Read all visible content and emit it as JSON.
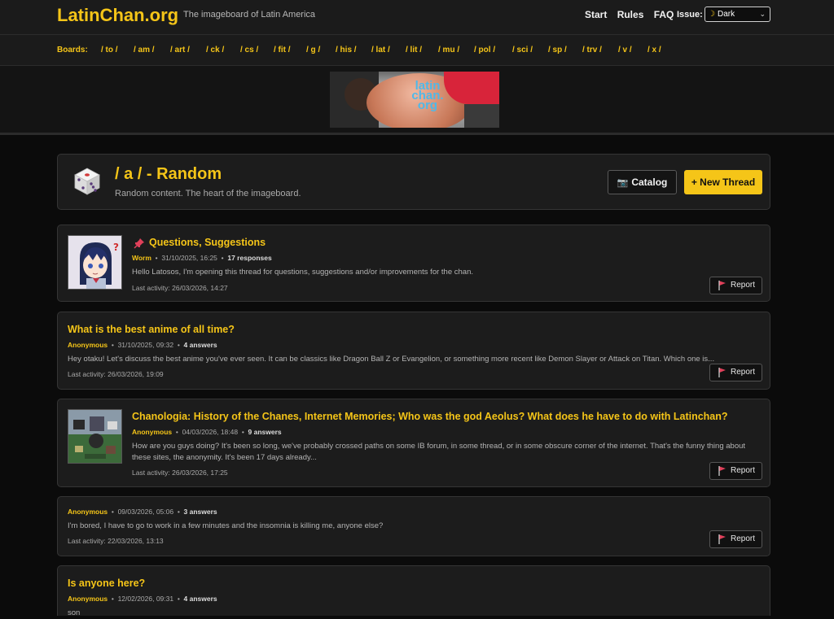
{
  "header": {
    "logo": "LatinChan.org",
    "tagline": "The imageboard of Latin America",
    "nav": [
      "Start",
      "Rules",
      "FAQ"
    ],
    "theme_label": "Issue:",
    "theme_value": "Dark"
  },
  "boards": {
    "label": "Boards:",
    "items": [
      "/ to /",
      "/ am /",
      "/ art /",
      "/ ck /",
      "/ cs /",
      "/ fit /",
      "/ g /",
      "/ his /",
      "/ lat /",
      "/ lit /",
      "/ mu /",
      "/ pol /",
      "/ sci /",
      "/ sp /",
      "/ trv /",
      "/ v /",
      "/ x /"
    ]
  },
  "banner": {
    "text_line1": "latin",
    "text_line2": "chan.",
    "text_line3": "org"
  },
  "board_header": {
    "title": "/ a / - Random",
    "description": "Random content. The heart of the imageboard.",
    "catalog_label": "Catalog",
    "new_thread_label": "+ New Thread"
  },
  "threads": [
    {
      "title": "Questions, Suggestions",
      "pinned": true,
      "author": "Worm",
      "date": "31/10/2025, 16:25",
      "count": "17 responses",
      "body": "Hello Latosos, I'm opening this thread for questions, suggestions and/or improvements for the chan.",
      "last_activity": "Last activity: 26/03/2026, 14:27",
      "report": "Report"
    },
    {
      "title": "What is the best anime of all time?",
      "author": "Anonymous",
      "date": "31/10/2025, 09:32",
      "count": "4 answers",
      "body": "Hey otaku! Let's discuss the best anime you've ever seen. It can be classics like Dragon Ball Z or Evangelion, or something more recent like Demon Slayer or Attack on Titan. Which one is...",
      "last_activity": "Last activity: 26/03/2026, 19:09",
      "report": "Report"
    },
    {
      "title": "Chanologia: History of the Chanes, Internet Memories; Who was the god Aeolus? What does he have to do with Latinchan?",
      "author": "Anonymous",
      "date": "04/03/2026, 18:48",
      "count": "9 answers",
      "body": "How are you guys doing? It's been so long, we've probably crossed paths on some IB forum, in some thread, or in some obscure corner of the internet. That's the funny thing about these sites, the anonymity. It's been 17 days already...",
      "last_activity": "Last activity: 26/03/2026, 17:25",
      "report": "Report"
    },
    {
      "author": "Anonymous",
      "date": "09/03/2026, 05:06",
      "count": "3 answers",
      "body": "I'm bored, I have to go to work in a few minutes and the insomnia is killing me, anyone else?",
      "last_activity": "Last activity: 22/03/2026, 13:13",
      "report": "Report"
    },
    {
      "title": "Is anyone here?",
      "author": "Anonymous",
      "date": "12/02/2026, 09:31",
      "count": "4 answers",
      "body": "son"
    }
  ],
  "colors": {
    "accent": "#f5c518",
    "background": "#0b0b0b",
    "card": "#1c1c1c",
    "flag": "#e0405a"
  }
}
